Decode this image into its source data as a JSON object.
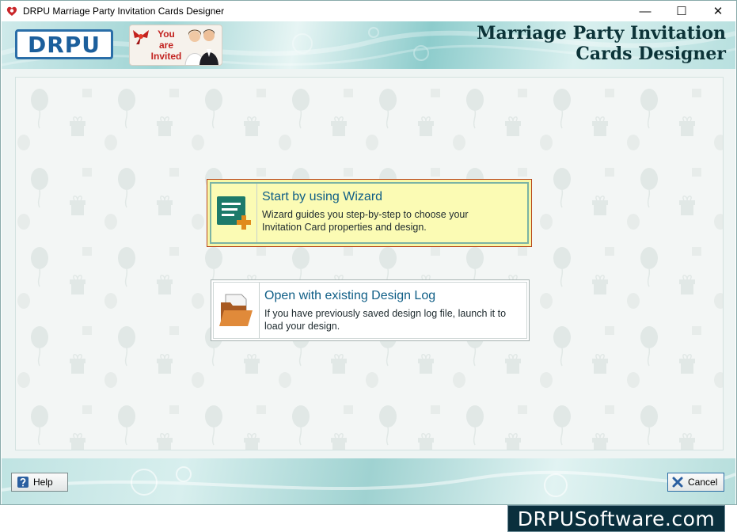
{
  "window": {
    "title": "DRPU Marriage Party Invitation Cards Designer",
    "minimize_glyph": "—",
    "maximize_glyph": "☐",
    "close_glyph": "✕"
  },
  "header": {
    "logo_text": "DRPU",
    "badge_lines": [
      "You",
      "are",
      "Invited"
    ],
    "title_line1": "Marriage Party Invitation",
    "title_line2": "Cards Designer"
  },
  "options": {
    "wizard": {
      "title": "Start by using Wizard",
      "description_line1": "Wizard guides you step-by-step to choose your",
      "description_line2": "Invitation Card properties and design.",
      "icon": "wizard-form-icon"
    },
    "design_log": {
      "title": "Open with existing Design Log",
      "description_line1": "If you have previously saved design log file, launch it to",
      "description_line2": "load your design.",
      "icon": "open-folder-icon"
    }
  },
  "footer": {
    "help_label": "Help",
    "cancel_label": "Cancel"
  },
  "watermark": "DRPUSoftware.com",
  "colors": {
    "accent": "#0f5e86",
    "wizard_highlight": "#f7f7a6",
    "logo_blue": "#1c5f9c",
    "watermark_bg": "#0a2f3d"
  }
}
